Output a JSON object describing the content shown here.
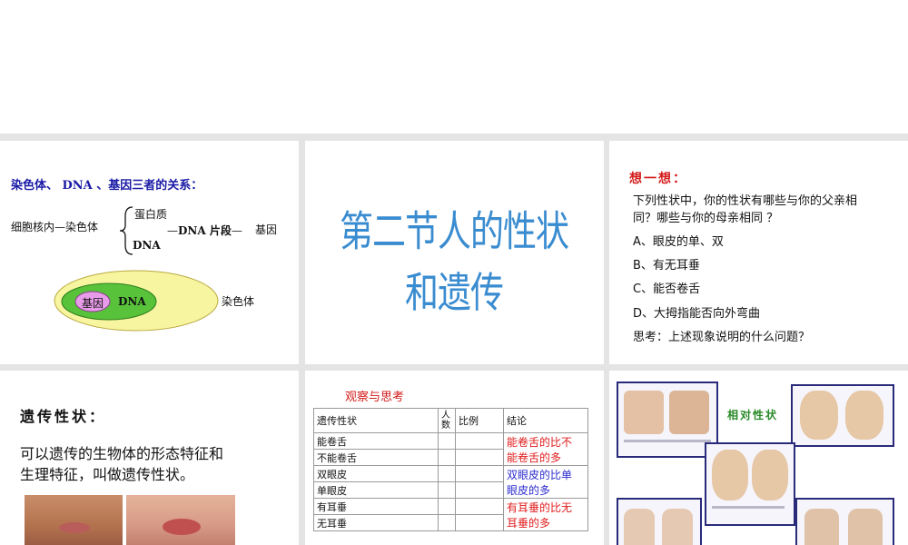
{
  "slide1": {
    "title": "染色体、 DNA 、基因三者的关系：",
    "nucleus": "细胞核内",
    "chromosome": "染色体",
    "protein": "蛋白质",
    "dna": "DNA",
    "dna_segment": "DNA 片段",
    "gene": "基因",
    "diagram_gene": "基因",
    "diagram_dna": "DNA",
    "diagram_chromosome": "染色体",
    "colors": {
      "outer": "#f7f5a0",
      "middle": "#58c23a",
      "inner": "#e79be8"
    }
  },
  "slide2": {
    "title": "第二节人的性状和遗传"
  },
  "slide3": {
    "heading": "想一想：",
    "question": "下列性状中，你的性状有哪些与你的父亲相同？哪些与你的母亲相同  ？",
    "question_line1": "下列性状中，你的性状有哪些与你的父亲相",
    "question_line2": "同？哪些与你的母亲相同  ？",
    "options": [
      "A、眼皮的单、双",
      "B、有无耳垂",
      "C、能否卷舌",
      "D、大拇指能否向外弯曲"
    ],
    "think": "思考：上述现象说明的什么问题？"
  },
  "slide4": {
    "heading": "遗传性状：",
    "definition_line1": "可以遗传的生物体的形态特征和",
    "definition_line2": "生理特征，叫做遗传性状。"
  },
  "slide5": {
    "heading": "观察与思考",
    "headers": [
      "遗传性状",
      "人数",
      "比例",
      "结论"
    ],
    "header_people_1": "人",
    "header_people_2": "数",
    "rows": [
      "能卷舌",
      "不能卷舌",
      "双眼皮",
      "单眼皮",
      "有耳垂",
      "无耳垂"
    ],
    "conclusion_1a": "能卷舌的比不",
    "conclusion_1b": "能卷舌的多",
    "conclusion_2a": "双眼皮的比单",
    "conclusion_2b": "眼皮的多",
    "conclusion_3a": "有耳垂的比无",
    "conclusion_3b": "耳垂的多"
  },
  "slide6": {
    "heading": "相对性状"
  }
}
